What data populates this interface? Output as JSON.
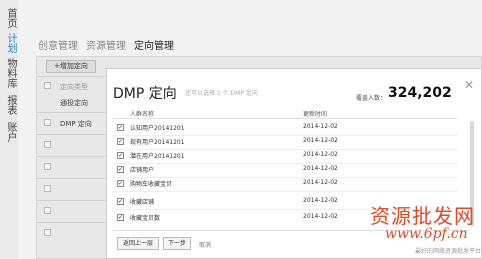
{
  "leftnav": {
    "items": [
      {
        "label": "首页",
        "active": false
      },
      {
        "label": "计划",
        "active": true
      },
      {
        "label": "物料库",
        "active": false
      },
      {
        "label": "报表",
        "active": false
      },
      {
        "label": "账户",
        "active": false
      }
    ]
  },
  "tabs": [
    "创意管理",
    "资源管理",
    "定向管理"
  ],
  "background": {
    "add_button": "+增加定向",
    "filter_label": "定向类型",
    "filter_sub": "通投定向",
    "row_label": "DMP 定向"
  },
  "modal": {
    "title": "DMP 定向",
    "hint": "还可以选择 1 个 DMP 定向",
    "count_label": "覆盖人数：",
    "count_value": "324,202",
    "col_name": "人群名称",
    "col_time": "更新时间",
    "rows": [
      {
        "name": "认知用户20141201",
        "date": "2014-12-02",
        "checked": true
      },
      {
        "name": "现有用户20141201",
        "date": "2014-12-02",
        "checked": true
      },
      {
        "name": "潜在用户20141201",
        "date": "2014-12-02",
        "checked": true
      },
      {
        "name": "店铺用户",
        "date": "2014-12-02",
        "checked": true
      },
      {
        "name": "购物车收藏宝贝",
        "date": "2014-12-02",
        "checked": true
      },
      {
        "name": "收藏店铺",
        "date": "2014-12-02",
        "checked": true
      },
      {
        "name": "收藏宝贝数",
        "date": "2014-12-02",
        "checked": true
      }
    ],
    "prev_button": "返回上一层",
    "next_button": "下一步",
    "cancel_link": "取消"
  },
  "watermark": {
    "line1": "资源批发网",
    "line2": "www.6pf.cn",
    "line3": "最好的网络资源批发平台"
  }
}
